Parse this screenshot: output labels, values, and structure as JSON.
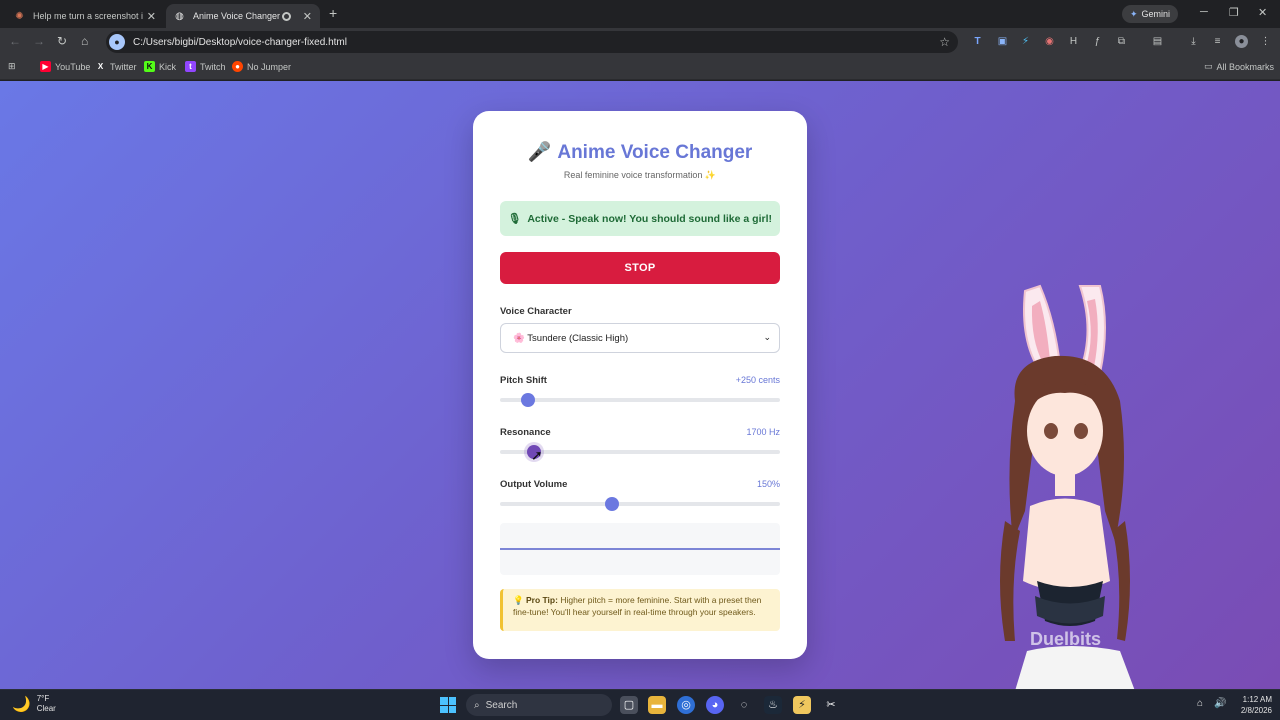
{
  "browser": {
    "tabs": [
      {
        "title": "Help me turn a screenshot into",
        "active": false
      },
      {
        "title": "Anime Voice Changer",
        "active": true
      }
    ],
    "gemini_label": "Gemini",
    "url": "C:/Users/bigbi/Desktop/voice-changer-fixed.html",
    "bookmarks": [
      "YouTube",
      "Twitter",
      "Kick",
      "Twitch",
      "No Jumper"
    ],
    "all_bookmarks_label": "All Bookmarks"
  },
  "app": {
    "title": "Anime Voice Changer",
    "subtitle": "Real feminine voice transformation ✨",
    "status_text": "Active - Speak now! You should sound like a girl!",
    "stop_label": "STOP",
    "voice_character": {
      "label": "Voice Character",
      "selected": "🌸 Tsundere (Classic High)"
    },
    "pitch": {
      "label": "Pitch Shift",
      "value_text": "+250 cents",
      "fraction": 0.1
    },
    "resonance": {
      "label": "Resonance",
      "value_text": "1700 Hz",
      "fraction": 0.12
    },
    "volume": {
      "label": "Output Volume",
      "value_text": "150%",
      "fraction": 0.4
    },
    "tip": {
      "title": "Pro Tip:",
      "text": "Higher pitch = more feminine. Start with a preset then fine-tune! You'll hear yourself in real-time through your speakers."
    }
  },
  "overlay": {
    "watermark": "Duelbits"
  },
  "taskbar": {
    "weather_temp": "7°F",
    "weather_cond": "Clear",
    "search_placeholder": "Search",
    "time": "1:12 AM",
    "date": "2/8/2026"
  },
  "colors": {
    "accent": "#6877d6",
    "stop": "#d81c3f",
    "status_bg": "#d4f2dd",
    "tip_border": "#f1c232"
  }
}
